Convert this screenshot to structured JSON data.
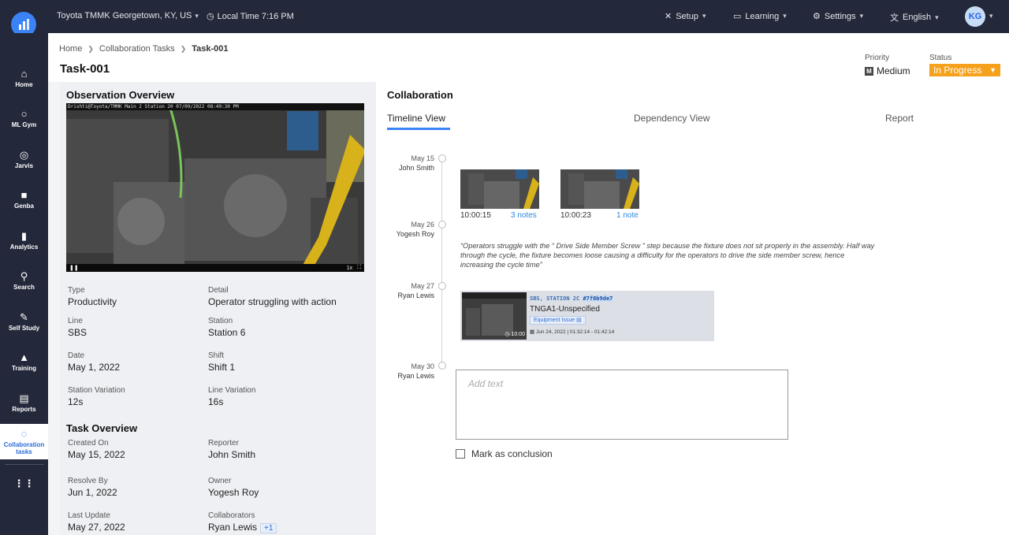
{
  "topbar": {
    "site": "Toyota TMMK Georgetown, KY, US",
    "time": "Local Time 7:16 PM",
    "menus": {
      "setup": "Setup",
      "learning": "Learning",
      "settings": "Settings",
      "language": "English"
    },
    "avatar": "KG"
  },
  "sidebar": {
    "home": "Home",
    "mlgym": "ML Gym",
    "jarvis": "Jarvis",
    "genba": "Genba",
    "analytics": "Analytics",
    "search": "Search",
    "selfstudy": "Self Study",
    "training": "Training",
    "reports": "Reports",
    "collab_line1": "Collaboration",
    "collab_line2": "tasks"
  },
  "breadcrumb": {
    "home": "Home",
    "tasks": "Collaboration Tasks",
    "current": "Task-001"
  },
  "page": {
    "title": "Task-001",
    "priority_label": "Priority",
    "priority_badge": "M",
    "priority_value": "Medium",
    "status_label": "Status",
    "status_value": "In Progress"
  },
  "observation": {
    "title": "Observation Overview",
    "video_overlay": "Drishti@Toyota/TMMK Main 2 Station 20 07/09/2022 08:49:30 PM",
    "video_speed": "1x",
    "type_label": "Type",
    "type": "Productivity",
    "detail_label": "Detail",
    "detail": "Operator struggling with action",
    "line_label": "Line",
    "line": "SBS",
    "station_label": "Station",
    "station": "Station 6",
    "date_label": "Date",
    "date": "May 1, 2022",
    "shift_label": "Shift",
    "shift": "Shift 1",
    "station_var_label": "Station Variation",
    "station_var": "12s",
    "line_var_label": "Line Variation",
    "line_var": "16s"
  },
  "task": {
    "title": "Task Overview",
    "created_label": "Created On",
    "created": "May 15, 2022",
    "reporter_label": "Reporter",
    "reporter": "John Smith",
    "resolve_label": "Resolve By",
    "resolve": "Jun 1, 2022",
    "owner_label": "Owner",
    "owner": "Yogesh Roy",
    "update_label": "Last Update",
    "update": "May 27, 2022",
    "collab_label": "Collaborators",
    "collab": "Ryan Lewis",
    "collab_more": "+1"
  },
  "collaboration": {
    "title": "Collaboration",
    "tabs": {
      "timeline": "Timeline View",
      "dependency": "Dependency View",
      "report": "Report"
    },
    "timeline": [
      {
        "date": "May 15",
        "name": "John Smith"
      },
      {
        "date": "May 26",
        "name": "Yogesh Roy"
      },
      {
        "date": "May 27",
        "name": "Ryan Lewis"
      },
      {
        "date": "May 30",
        "name": "Ryan Lewis"
      }
    ],
    "thumbs": [
      {
        "time": "10:00:15",
        "notes": "3 notes"
      },
      {
        "time": "10:00:23",
        "notes": "1 note"
      }
    ],
    "quote": "“Operators struggle with the “ Drive Side Member Screw ” step because the fixture does not sit properly in the assembly. Half way through the cycle, the fixture becomes loose causing a difficulty for the operators to drive the side member screw, hence increasing the cycle time”",
    "card": {
      "camera": "SBS, STATION 2C",
      "hash": "#7f0b9de7",
      "title": "TNGA1-Unspecified",
      "tag": "Equipment Issue",
      "date": "Jun 24, 2022 | 01:32:14 - 01:42:14",
      "duration": "10:00"
    },
    "add_text_placeholder": "Add text",
    "conclusion_label": "Mark as conclusion"
  }
}
